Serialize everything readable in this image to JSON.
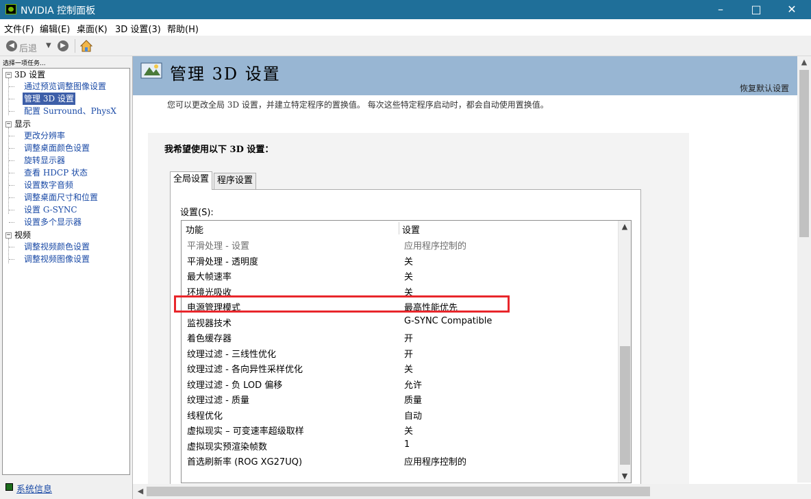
{
  "window": {
    "title": "NVIDIA 控制面板"
  },
  "menubar": {
    "items": [
      "文件(F)",
      "编辑(E)",
      "桌面(K)",
      "3D 设置(3)",
      "帮助(H)"
    ]
  },
  "toolbar": {
    "back_label": "后退"
  },
  "sidebar": {
    "prompt": "选择一项任务...",
    "categories": [
      "3D 设置",
      "显示",
      "视频"
    ],
    "items_3d": [
      "通过预览调整图像设置",
      "管理 3D 设置",
      "配置 Surround、PhysX"
    ],
    "items_display": [
      "更改分辨率",
      "调整桌面颜色设置",
      "旋转显示器",
      "查看 HDCP 状态",
      "设置数字音频",
      "调整桌面尺寸和位置",
      "设置 G-SYNC",
      "设置多个显示器"
    ],
    "items_video": [
      "调整视频颜色设置",
      "调整视频图像设置"
    ],
    "selected": "管理 3D 设置",
    "sysinfo_label": "系统信息"
  },
  "main": {
    "title": "管理 3D 设置",
    "restore_label": "恢复默认设置",
    "description": "您可以更改全局 3D 设置，并建立特定程序的置换值。 每次这些特定程序启动时，都会自动使用置换值。",
    "section_title": "我希望使用以下 3D 设置：",
    "tabs": [
      "全局设置",
      "程序设置"
    ],
    "active_tab": "全局设置",
    "settings_label": "设置(S):",
    "columns": [
      "功能",
      "设置"
    ],
    "rows": [
      {
        "feature": "平滑处理 - 设置",
        "value": "应用程序控制的"
      },
      {
        "feature": "平滑处理 - 透明度",
        "value": "关"
      },
      {
        "feature": "最大帧速率",
        "value": "关"
      },
      {
        "feature": "环境光吸收",
        "value": "关"
      },
      {
        "feature": "电源管理模式",
        "value": "最高性能优先"
      },
      {
        "feature": "监视器技术",
        "value": "G-SYNC Compatible"
      },
      {
        "feature": "着色缓存器",
        "value": "开"
      },
      {
        "feature": "纹理过滤 - 三线性优化",
        "value": "开"
      },
      {
        "feature": "纹理过滤 - 各向异性采样优化",
        "value": "关"
      },
      {
        "feature": "纹理过滤 - 负 LOD 偏移",
        "value": "允许"
      },
      {
        "feature": "纹理过滤 - 质量",
        "value": "质量"
      },
      {
        "feature": "线程优化",
        "value": "自动"
      },
      {
        "feature": "虚拟现实 – 可变速率超级取样",
        "value": "关"
      },
      {
        "feature": "虚拟现实预渲染帧数",
        "value": "1"
      },
      {
        "feature": "首选刷新率 (ROG XG27UQ)",
        "value": "应用程序控制的"
      }
    ],
    "highlighted_row": "电源管理模式"
  },
  "colors": {
    "titlebar": "#1f6f99",
    "banner": "#98b6d3",
    "highlight": "#e8262b",
    "selection": "#3d5ea8",
    "link": "#1a4aa6"
  },
  "icons": [
    "nvidia-app-icon",
    "back-arrow-icon",
    "forward-arrow-icon",
    "home-icon",
    "3d-settings-banner-icon",
    "system-info-icon"
  ]
}
